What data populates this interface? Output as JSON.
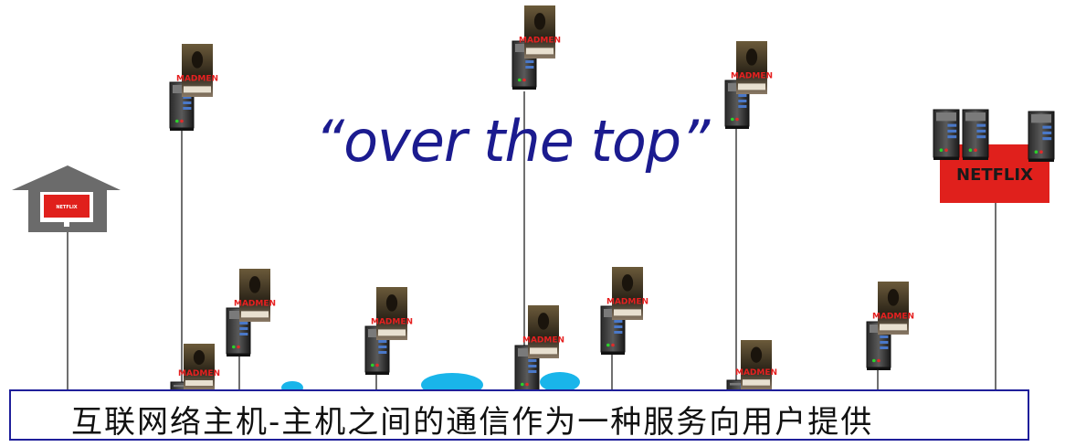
{
  "title": "“over the top”",
  "caption": "互联网络主机-主机之间的通信作为一种服务向用户提供",
  "poster_label": "MADMEN",
  "provider_logo": "NETFLIX",
  "colors": {
    "title": "#1b1b8f",
    "caption_border": "#1f1f9a",
    "netflix_red": "#e0201c",
    "cloud": "#19b5ea",
    "house": "#6b6b6b"
  },
  "icons": [
    "house-icon",
    "tv-icon",
    "server-icon",
    "poster-icon",
    "cloud-icon",
    "netflix-logo"
  ]
}
